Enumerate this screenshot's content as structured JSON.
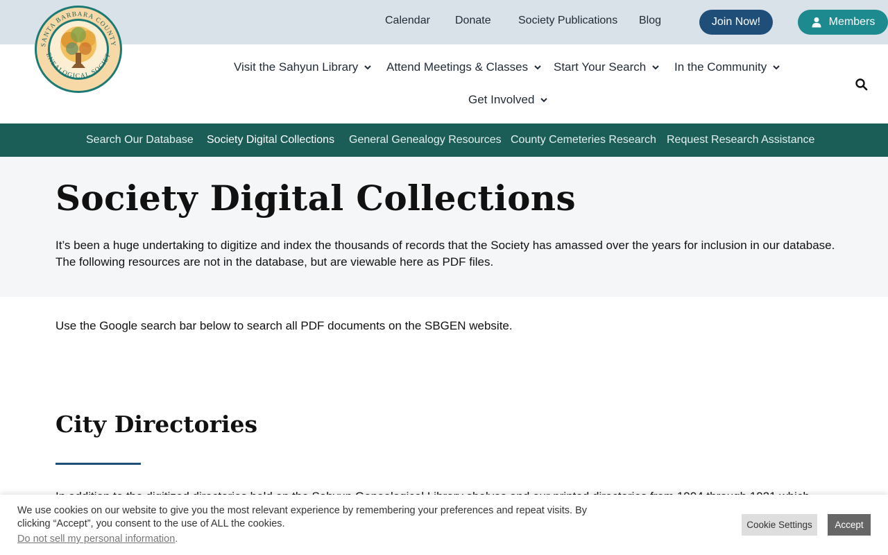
{
  "logo": {
    "lettering": "SANTA BARBARA COUNTY GENEALOGICAL SOCIETY",
    "icon": "tree-emblem"
  },
  "topbar": {
    "links": [
      "Calendar",
      "Donate",
      "Society Publications",
      "Blog"
    ],
    "join_label": "Join Now!",
    "members_label": "Members",
    "members_icon": "user-icon"
  },
  "mainnav": {
    "items": [
      "Visit the Sahyun Library",
      "Attend Meetings & Classes",
      "Start Your Search",
      "In the Community",
      "Get Involved"
    ],
    "search_icon": "search-icon"
  },
  "subnav": {
    "items": [
      "Search Our Database",
      "Society Digital Collections",
      "General Genealogy Resources",
      "County Cemeteries Research",
      "Request Research Assistance"
    ],
    "active": "Society Digital Collections"
  },
  "page": {
    "title": "Society Digital Collections",
    "intro": "It’s been a huge undertaking to digitize and index the thousands of records that the Society has amassed over the years for inclusion in our database. The following resources are not in the database, but are viewable here as PDF files.",
    "search_note": "Use the Google search bar below to search all PDF documents on the SBGEN website.",
    "section_title": "City Directories",
    "section_text_cut": "In addition to the digitized directories held on the Sahyun Genealogical Library shelves and our printed directories from 1904 through 1921 which"
  },
  "cookie": {
    "message": "We use cookies on our website to give you the most relevant experience by remembering your preferences and repeat visits. By clicking “Accept”, you consent to the use of ALL the cookies.",
    "dns_link": "Do not sell my personal information",
    "dns_suffix": ".",
    "settings_label": "Cookie Settings",
    "accept_label": "Accept"
  },
  "colors": {
    "topbar_bg": "#d9e2e8",
    "join_bg": "#1f4e79",
    "members_bg": "#1c8a8f",
    "subnav_bg": "#1b5e58",
    "hero_bg": "#f4f6f8",
    "rule": "#1f4e79"
  }
}
